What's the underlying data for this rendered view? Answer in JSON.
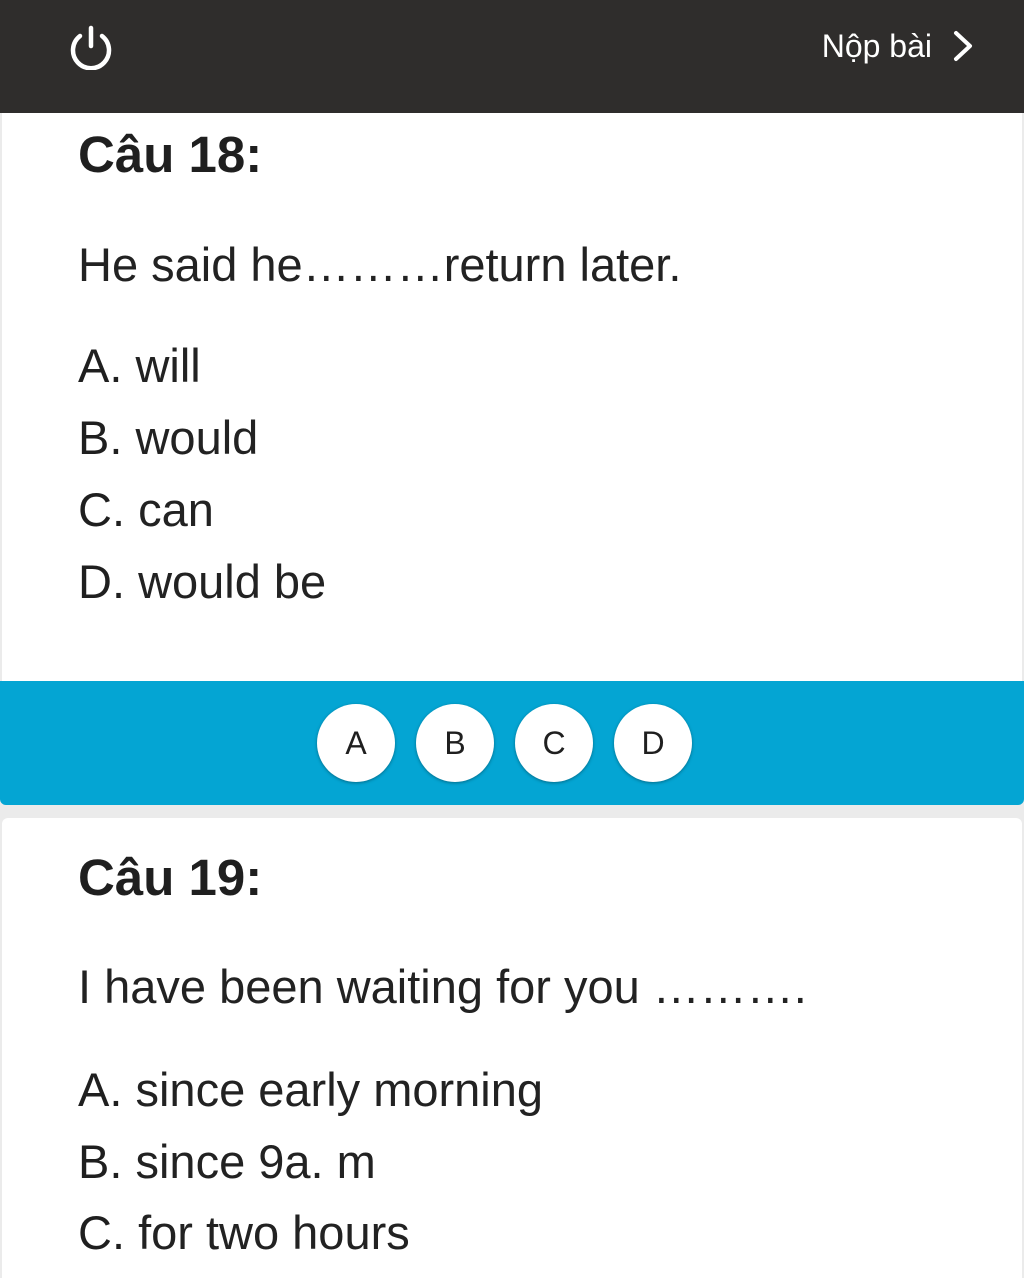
{
  "header": {
    "submit_label": "Nộp bài",
    "power_icon": "power-icon",
    "chevron_icon": "chevron-right-icon"
  },
  "questions": [
    {
      "title": "Câu 18:",
      "text": "He said he………return later.",
      "options": [
        {
          "letter": "A.",
          "text": "will"
        },
        {
          "letter": "B.",
          "text": "would"
        },
        {
          "letter": "C.",
          "text": "can"
        },
        {
          "letter": "D.",
          "text": "would be"
        }
      ]
    },
    {
      "title": "Câu 19:",
      "text": "I have been waiting for you ……….",
      "options": [
        {
          "letter": "A.",
          "text": "since early morning"
        },
        {
          "letter": "B.",
          "text": "since 9a. m"
        },
        {
          "letter": "C.",
          "text": "for two hours"
        }
      ]
    }
  ],
  "answer_bar": {
    "buttons": [
      "A",
      "B",
      "C",
      "D"
    ]
  },
  "colors": {
    "header_bg": "#2f2d2c",
    "answer_bar_bg": "#04a5d3",
    "page_bg": "#ebebeb"
  }
}
